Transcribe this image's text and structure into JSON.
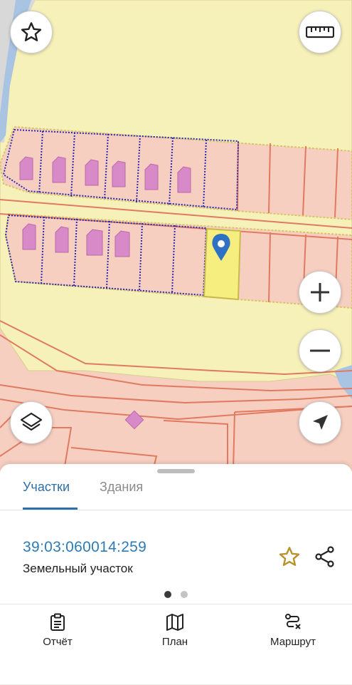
{
  "map": {
    "colors": {
      "background": "#f7cfc1",
      "zone": "#f6f1b8",
      "selected_parcel": "#f6ee7e",
      "building": "#d88ac8",
      "boundary": "#e07a60",
      "cadastral_border": "#2b2bb0",
      "river": "#a9c3e2"
    },
    "controls": {
      "favorite_icon": "star-outline-icon",
      "ruler_icon": "ruler-icon",
      "zoom_in_icon": "plus-icon",
      "zoom_out_icon": "minus-icon",
      "layers_icon": "layers-icon",
      "locate_icon": "navigation-arrow-icon"
    },
    "marker_icon": "map-pin-icon"
  },
  "panel": {
    "tabs": [
      {
        "label": "Участки",
        "active": true
      },
      {
        "label": "Здания",
        "active": false
      }
    ],
    "parcel": {
      "cadastral_number": "39:03:060014:259",
      "type": "Земельный участок",
      "favorite_icon": "star-outline-icon",
      "share_icon": "share-icon"
    },
    "pager": {
      "count": 2,
      "active_index": 0
    },
    "accent_color": "#2d6fa8"
  },
  "bottom_nav": [
    {
      "label": "Отчёт",
      "icon": "clipboard-icon"
    },
    {
      "label": "План",
      "icon": "map-icon"
    },
    {
      "label": "Маршрут",
      "icon": "route-icon"
    }
  ]
}
